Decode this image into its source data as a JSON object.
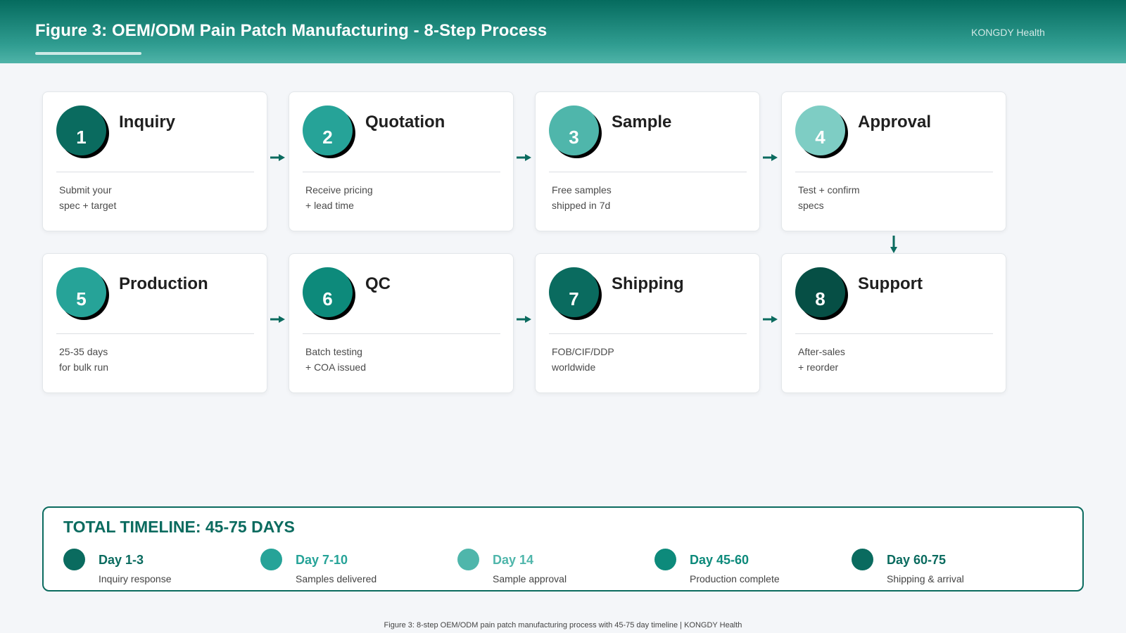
{
  "header": {
    "title": "Figure 3: OEM/ODM Pain Patch Manufacturing - 8-Step Process",
    "brand": "KONGDY Health"
  },
  "steps": [
    {
      "number": "1",
      "title": "Inquiry",
      "desc": [
        "Submit your",
        "spec + target"
      ],
      "color": "#0a6b5f"
    },
    {
      "number": "2",
      "title": "Quotation",
      "desc": [
        "Receive pricing",
        "+ lead time"
      ],
      "color": "#26a398"
    },
    {
      "number": "3",
      "title": "Sample",
      "desc": [
        "Free samples",
        "shipped in 7d"
      ],
      "color": "#4fb6ab"
    },
    {
      "number": "4",
      "title": "Approval",
      "desc": [
        "Test + confirm",
        "specs"
      ],
      "color": "#7ecdc4"
    },
    {
      "number": "5",
      "title": "Production",
      "desc": [
        "25-35 days",
        "for bulk run"
      ],
      "color": "#26a398"
    },
    {
      "number": "6",
      "title": "QC",
      "desc": [
        "Batch testing",
        "+ COA issued"
      ],
      "color": "#0d8a7b"
    },
    {
      "number": "7",
      "title": "Shipping",
      "desc": [
        "FOB/CIF/DDP",
        "worldwide"
      ],
      "color": "#0a6b5f"
    },
    {
      "number": "8",
      "title": "Support",
      "desc": [
        "After-sales",
        "+ reorder"
      ],
      "color": "#064f45"
    }
  ],
  "timeline": {
    "title": "TOTAL TIMELINE: 45-75 DAYS",
    "milestones": [
      {
        "day": "Day 1-3",
        "desc": "Inquiry response",
        "color": "#0a6b5f"
      },
      {
        "day": "Day 7-10",
        "desc": "Samples delivered",
        "color": "#26a398"
      },
      {
        "day": "Day 14",
        "desc": "Sample approval",
        "color": "#4fb6ab"
      },
      {
        "day": "Day 45-60",
        "desc": "Production complete",
        "color": "#0d8a7b"
      },
      {
        "day": "Day 60-75",
        "desc": "Shipping & arrival",
        "color": "#0a6b5f"
      }
    ]
  },
  "footer": {
    "caption": "Figure 3: 8-step OEM/ODM pain patch manufacturing process with 45-75 day timeline | KONGDY Health"
  },
  "colors": {
    "accent": "#0b6b5f",
    "arrow": "#0b6b5f"
  }
}
